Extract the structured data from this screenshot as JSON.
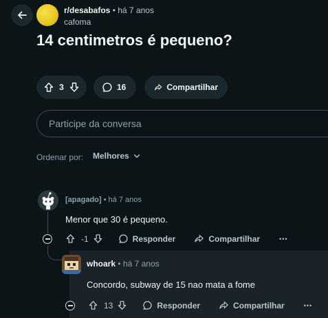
{
  "post": {
    "subreddit": "r/desabafos",
    "separator": "•",
    "time": "há 7 anos",
    "author": "cafoma",
    "title": "14 centimetros é pequeno?",
    "score": "3",
    "comments": "16",
    "share_label": "Compartilhar"
  },
  "comment_input": {
    "placeholder": "Participe da conversa"
  },
  "sort": {
    "label": "Ordenar por:",
    "value": "Melhores"
  },
  "comments": [
    {
      "author": "[apagado]",
      "separator": "•",
      "time": "há 7 anos",
      "body": "Menor que 30 é pequeno.",
      "score": "-1",
      "reply_label": "Responder",
      "share_label": "Compartilhar",
      "more_label": "•••"
    },
    {
      "author": "whoark",
      "separator": "•",
      "time": "há 7 anos",
      "body": "Concordo, subway de 15 nao mata a fome",
      "score": "13",
      "reply_label": "Responder",
      "share_label": "Compartilhar",
      "more_label": "•••"
    }
  ],
  "colors": {
    "background": "#0b1416",
    "pill": "#1a282d",
    "reply_highlight": "#1a2327",
    "subreddit_icon": "#e9c520"
  }
}
